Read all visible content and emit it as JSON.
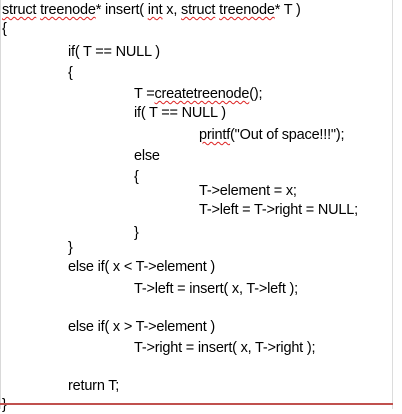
{
  "code": {
    "l01_a": "struct",
    "l01_b": " ",
    "l01_c": "treenode",
    "l01_d": "* insert( ",
    "l01_e": "int",
    "l01_f": " x, ",
    "l01_g": "struct",
    "l01_h": " ",
    "l01_i": "treenode",
    "l01_j": "* T )",
    "l02": "{",
    "l03": "if( T == NULL )",
    "l04": "{",
    "l05_a": "T =",
    "l05_b": "createtreenode",
    "l05_c": "();",
    "l06": "if( T == NULL )",
    "l07_a": "printf",
    "l07_b": "(\"Out of space!!!\");",
    "l08": "else",
    "l09": "{",
    "l10": "T->element = x;",
    "l11": "T->left = T->right = NULL;",
    "l12": "}",
    "l13": "}",
    "l14": "else if( x < T->element )",
    "l15": "T->left = insert( x, T->left );",
    "l16": "else if( x > T->element )",
    "l17": "T->right = insert( x, T->right );",
    "l18": "return T;",
    "l19": "}"
  },
  "colors": {
    "squiggle": "#d22",
    "rule": "#c0504d",
    "text": "#000000"
  }
}
